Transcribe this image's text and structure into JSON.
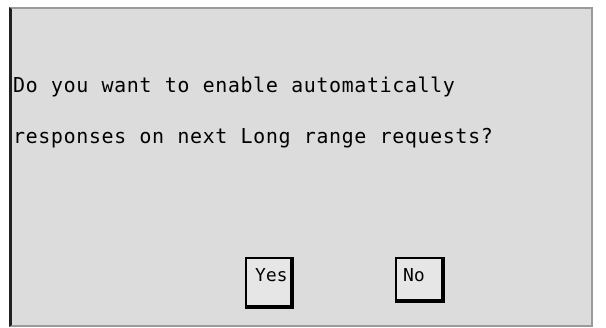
{
  "dialog": {
    "question_lines": [
      "Do you want to enable automatically",
      "responses on next Long range requests?"
    ],
    "yes_label": "Yes",
    "no_label": "No"
  }
}
